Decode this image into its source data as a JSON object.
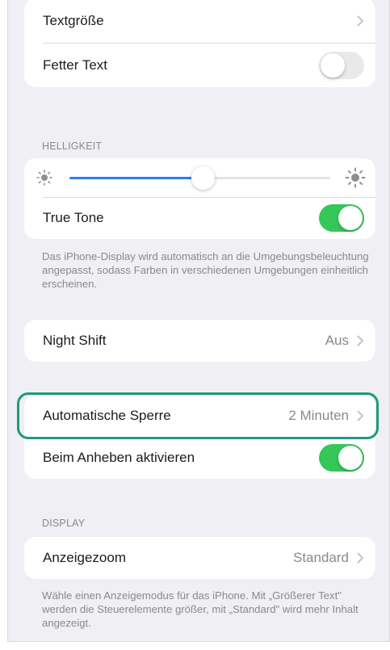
{
  "group_text": {
    "text_size_label": "Textgröße",
    "bold_text_label": "Fetter Text",
    "bold_text_on": false
  },
  "brightness": {
    "header": "HELLIGKEIT",
    "level": 0.51,
    "true_tone_label": "True Tone",
    "true_tone_on": true,
    "footnote": "Das iPhone-Display wird automatisch an die Umgebungsbeleuchtung angepasst, sodass Farben in verschiedenen Umgebungen einheitlich erscheinen."
  },
  "night_shift": {
    "label": "Night Shift",
    "value": "Aus"
  },
  "lock": {
    "auto_lock_label": "Automatische Sperre",
    "auto_lock_value": "2 Minuten",
    "raise_to_wake_label": "Beim Anheben aktivieren",
    "raise_to_wake_on": true
  },
  "display": {
    "header": "DISPLAY",
    "zoom_label": "Anzeigezoom",
    "zoom_value": "Standard",
    "footnote": "Wähle einen Anzeigemodus für das iPhone. Mit „Größerer Text\" werden die Steuerelemente größer, mit „Standard\" wird mehr Inhalt angezeigt."
  },
  "colors": {
    "switch_on": "#34c759",
    "slider_fill": "#2f7df6",
    "highlight": "#1e9a7c"
  },
  "icons": [
    "chevron-right-icon",
    "sun-small-icon",
    "sun-large-icon"
  ]
}
